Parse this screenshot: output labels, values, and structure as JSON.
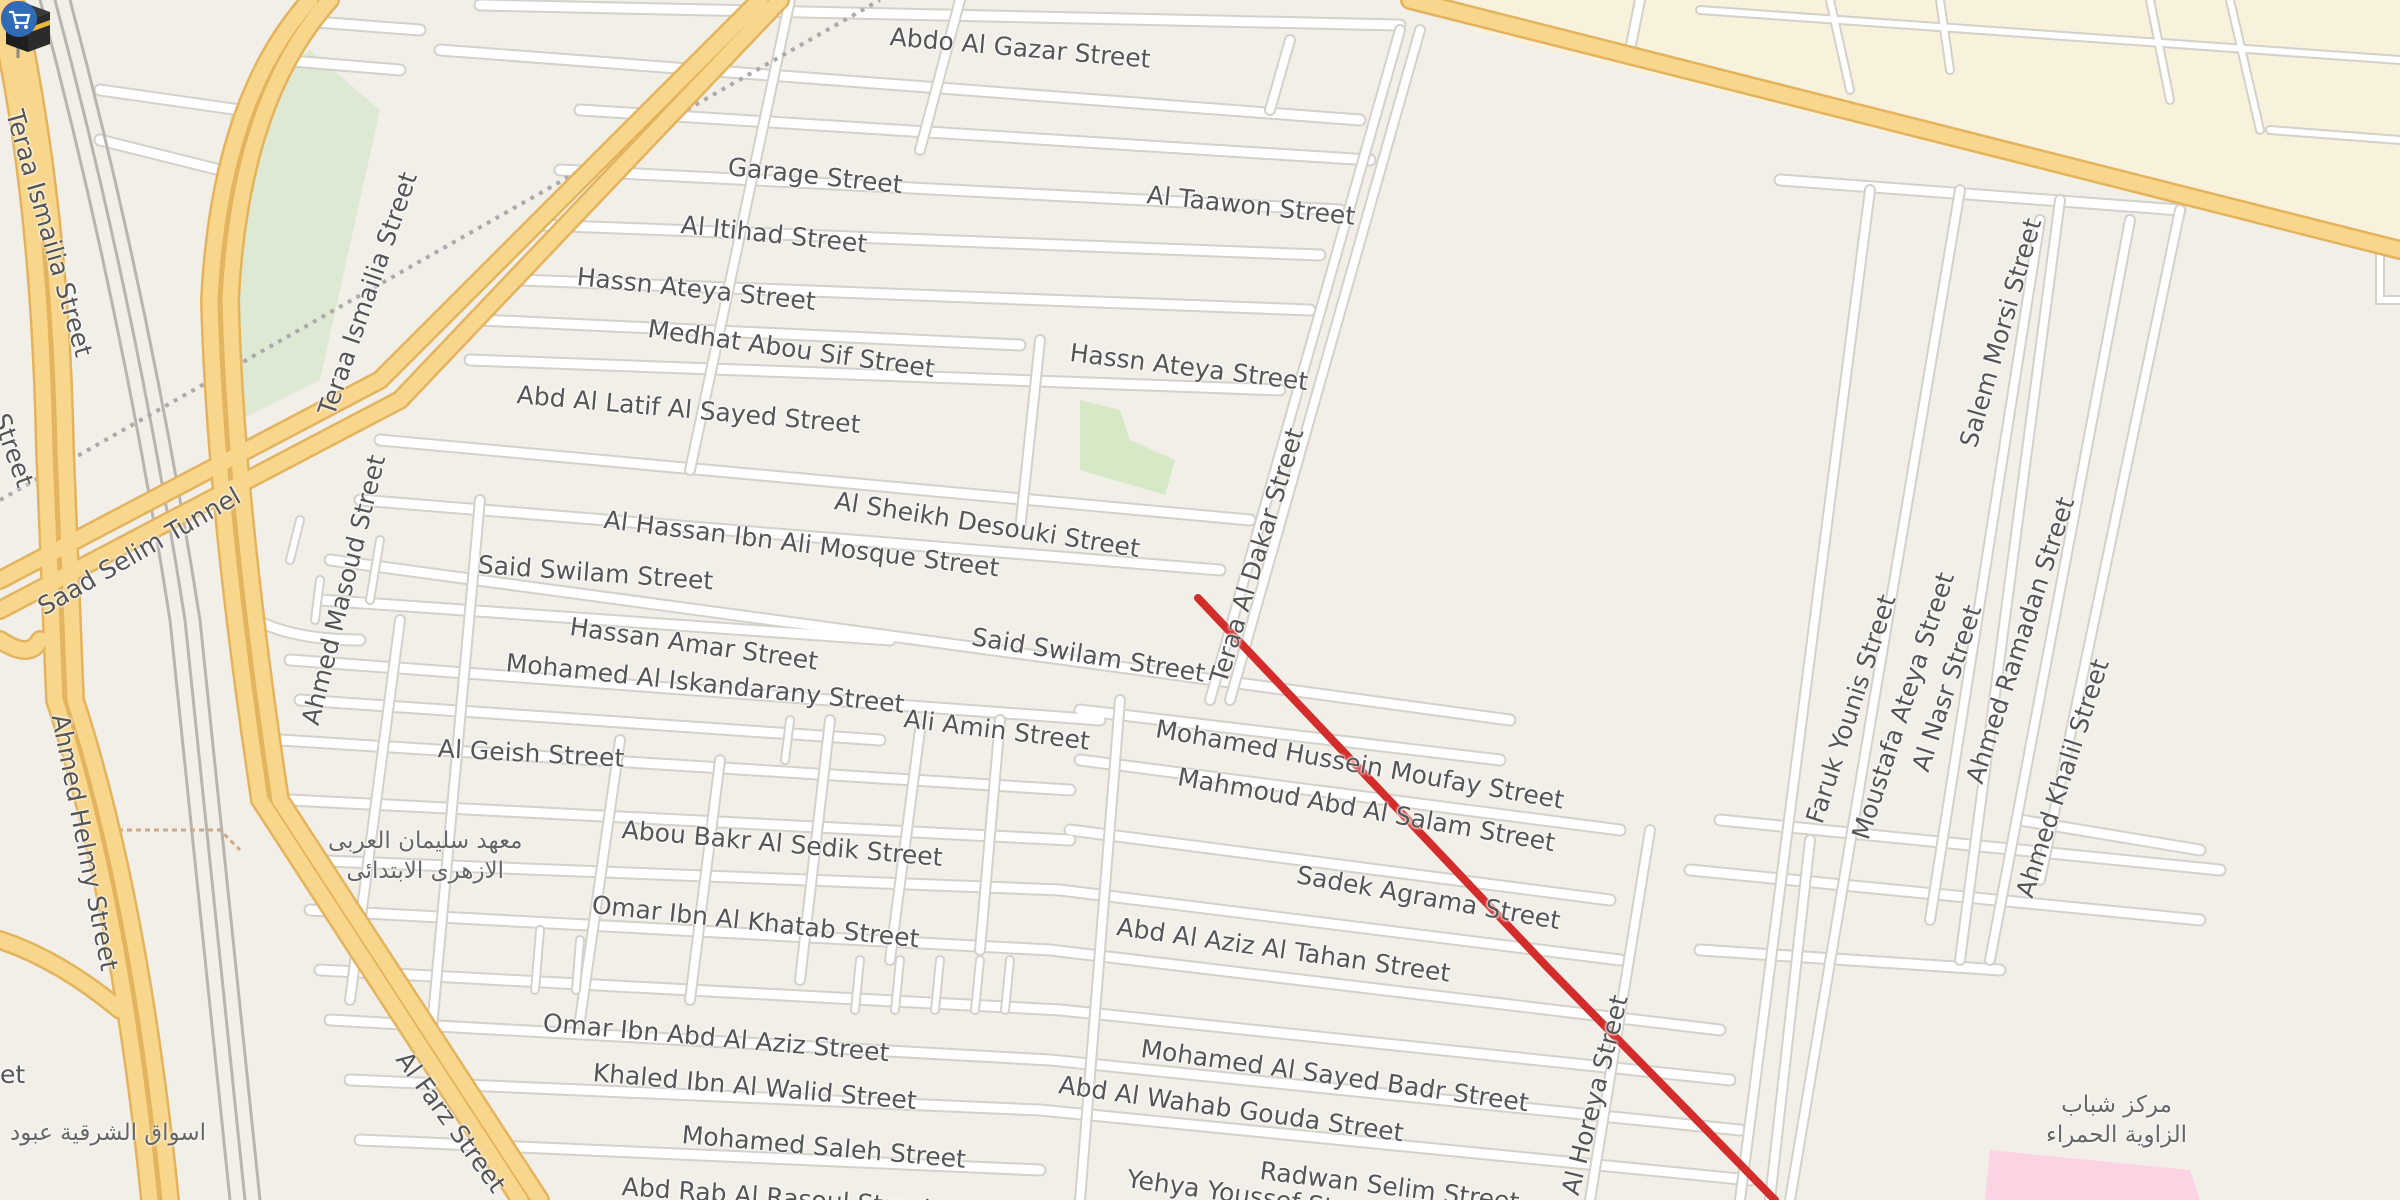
{
  "map": {
    "streets": [
      {
        "id": "abdo-al-gazar",
        "label": "Abdo Al Gazar Street"
      },
      {
        "id": "garage",
        "label": "Garage Street"
      },
      {
        "id": "al-taawon",
        "label": "Al Taawon Street"
      },
      {
        "id": "al-itihad",
        "label": "Al Itihad Street"
      },
      {
        "id": "hassn-ateya-1",
        "label": "Hassn Ateya Street"
      },
      {
        "id": "hassn-ateya-2",
        "label": "Hassn Ateya Street"
      },
      {
        "id": "medhat-abou-sif",
        "label": "Medhat Abou Sif Street"
      },
      {
        "id": "abd-al-latif",
        "label": "Abd Al Latif Al Sayed Street"
      },
      {
        "id": "al-sheikh-desouki",
        "label": "Al Sheikh Desouki Street"
      },
      {
        "id": "al-hassan-mosque",
        "label": "Al Hassan Ibn Ali Mosque Street"
      },
      {
        "id": "said-swilam-1",
        "label": "Said Swilam Street"
      },
      {
        "id": "said-swilam-2",
        "label": "Said Swilam Street"
      },
      {
        "id": "hassan-amar",
        "label": "Hassan Amar Street"
      },
      {
        "id": "mohamed-iskandarany",
        "label": "Mohamed Al Iskandarany Street"
      },
      {
        "id": "ali-amin",
        "label": "Ali Amin Street"
      },
      {
        "id": "al-geish",
        "label": "Al Geish Street"
      },
      {
        "id": "mohamed-moufay",
        "label": "Mohamed Hussein Moufay Street"
      },
      {
        "id": "mahmoud-salam",
        "label": "Mahmoud Abd Al Salam Street"
      },
      {
        "id": "abou-bakr",
        "label": "Abou Bakr Al Sedik Street"
      },
      {
        "id": "sadek-agrama",
        "label": "Sadek Agrama Street"
      },
      {
        "id": "omar-khatab",
        "label": "Omar Ibn Al Khatab Street"
      },
      {
        "id": "abd-al-aziz-tahan",
        "label": "Abd Al Aziz Al Tahan Street"
      },
      {
        "id": "omar-abd-al-aziz",
        "label": "Omar Ibn Abd Al Aziz Street"
      },
      {
        "id": "mohamed-badr",
        "label": "Mohamed Al Sayed Badr Street"
      },
      {
        "id": "khaled-walid",
        "label": "Khaled Ibn Al Walid Street"
      },
      {
        "id": "abd-al-wahab",
        "label": "Abd Al Wahab Gouda Street"
      },
      {
        "id": "mohamed-saleh",
        "label": "Mohamed Saleh Street"
      },
      {
        "id": "radwan-selim",
        "label": "Radwan Selim Street"
      },
      {
        "id": "abd-rab",
        "label": "Abd Rab Al Rasoul Street"
      },
      {
        "id": "yehya-youssef",
        "label": "Yehya Youssef Street"
      },
      {
        "id": "teraa-dakar",
        "label": "Teraa Al Dakar Street"
      },
      {
        "id": "al-horeya",
        "label": "Al Horeya Street"
      },
      {
        "id": "ahmed-masoud",
        "label": "Ahmed Masoud Street"
      },
      {
        "id": "teraa-ismailia-1",
        "label": "Teraa Ismailia Street"
      },
      {
        "id": "teraa-ismailia-2",
        "label": "Teraa Ismailia Street"
      },
      {
        "id": "saad-selim",
        "label": "Saad Selim Tunnel"
      },
      {
        "id": "ahmed-helmy",
        "label": "Ahmed Helmy Street"
      },
      {
        "id": "al-farz",
        "label": "Al Farz Street"
      },
      {
        "id": "faruk-younis",
        "label": "Faruk Younis Street"
      },
      {
        "id": "moustafa-ateya",
        "label": "Moustafa Ateya Street"
      },
      {
        "id": "al-nasr",
        "label": "Al Nasr Street"
      },
      {
        "id": "ahmed-ramadan",
        "label": "Ahmed Ramadan Street"
      },
      {
        "id": "ahmed-khalil",
        "label": "Ahmed Khalil Street"
      },
      {
        "id": "salem-morsi",
        "label": "Salem Morsi Street"
      },
      {
        "id": "edge-street",
        "label": "Street"
      },
      {
        "id": "edge-et",
        "label": "et"
      }
    ],
    "pois": {
      "school_line1": "معهد سليمان العربى",
      "school_line2": "الازهرى الابتدائى",
      "market": "اسواق الشرقية عبود",
      "youth_line1": "مركز شباب",
      "youth_line2": "الزاوية الحمراء"
    },
    "icons": {
      "pin": "map-pin-icon",
      "kaaba": "kaaba-icon",
      "market": "shopping-cart-icon"
    },
    "colors": {
      "background": "#f2efe9",
      "major_road": "#f8d68b",
      "major_road_casing": "#e3b35e",
      "route_line": "#d42b2b",
      "pin": "#e8336b",
      "park": "#d6e8c6",
      "residential": "#f8f1dc",
      "pink_zone": "#fbd3e3"
    }
  }
}
